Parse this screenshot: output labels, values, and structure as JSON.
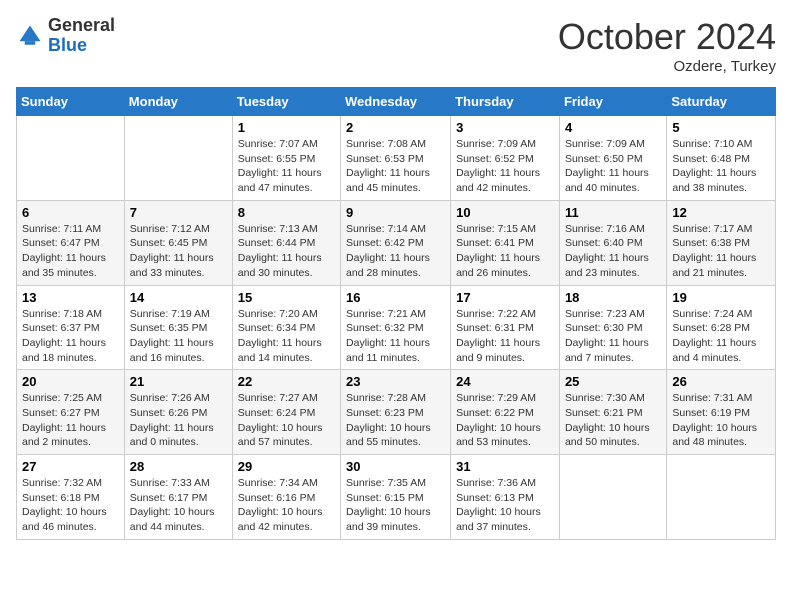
{
  "header": {
    "logo": {
      "general": "General",
      "blue": "Blue"
    },
    "title": "October 2024",
    "location": "Ozdere, Turkey"
  },
  "days_of_week": [
    "Sunday",
    "Monday",
    "Tuesday",
    "Wednesday",
    "Thursday",
    "Friday",
    "Saturday"
  ],
  "weeks": [
    [
      {
        "day": "",
        "sunrise": "",
        "sunset": "",
        "daylight": ""
      },
      {
        "day": "",
        "sunrise": "",
        "sunset": "",
        "daylight": ""
      },
      {
        "day": "1",
        "sunrise": "Sunrise: 7:07 AM",
        "sunset": "Sunset: 6:55 PM",
        "daylight": "Daylight: 11 hours and 47 minutes."
      },
      {
        "day": "2",
        "sunrise": "Sunrise: 7:08 AM",
        "sunset": "Sunset: 6:53 PM",
        "daylight": "Daylight: 11 hours and 45 minutes."
      },
      {
        "day": "3",
        "sunrise": "Sunrise: 7:09 AM",
        "sunset": "Sunset: 6:52 PM",
        "daylight": "Daylight: 11 hours and 42 minutes."
      },
      {
        "day": "4",
        "sunrise": "Sunrise: 7:09 AM",
        "sunset": "Sunset: 6:50 PM",
        "daylight": "Daylight: 11 hours and 40 minutes."
      },
      {
        "day": "5",
        "sunrise": "Sunrise: 7:10 AM",
        "sunset": "Sunset: 6:48 PM",
        "daylight": "Daylight: 11 hours and 38 minutes."
      }
    ],
    [
      {
        "day": "6",
        "sunrise": "Sunrise: 7:11 AM",
        "sunset": "Sunset: 6:47 PM",
        "daylight": "Daylight: 11 hours and 35 minutes."
      },
      {
        "day": "7",
        "sunrise": "Sunrise: 7:12 AM",
        "sunset": "Sunset: 6:45 PM",
        "daylight": "Daylight: 11 hours and 33 minutes."
      },
      {
        "day": "8",
        "sunrise": "Sunrise: 7:13 AM",
        "sunset": "Sunset: 6:44 PM",
        "daylight": "Daylight: 11 hours and 30 minutes."
      },
      {
        "day": "9",
        "sunrise": "Sunrise: 7:14 AM",
        "sunset": "Sunset: 6:42 PM",
        "daylight": "Daylight: 11 hours and 28 minutes."
      },
      {
        "day": "10",
        "sunrise": "Sunrise: 7:15 AM",
        "sunset": "Sunset: 6:41 PM",
        "daylight": "Daylight: 11 hours and 26 minutes."
      },
      {
        "day": "11",
        "sunrise": "Sunrise: 7:16 AM",
        "sunset": "Sunset: 6:40 PM",
        "daylight": "Daylight: 11 hours and 23 minutes."
      },
      {
        "day": "12",
        "sunrise": "Sunrise: 7:17 AM",
        "sunset": "Sunset: 6:38 PM",
        "daylight": "Daylight: 11 hours and 21 minutes."
      }
    ],
    [
      {
        "day": "13",
        "sunrise": "Sunrise: 7:18 AM",
        "sunset": "Sunset: 6:37 PM",
        "daylight": "Daylight: 11 hours and 18 minutes."
      },
      {
        "day": "14",
        "sunrise": "Sunrise: 7:19 AM",
        "sunset": "Sunset: 6:35 PM",
        "daylight": "Daylight: 11 hours and 16 minutes."
      },
      {
        "day": "15",
        "sunrise": "Sunrise: 7:20 AM",
        "sunset": "Sunset: 6:34 PM",
        "daylight": "Daylight: 11 hours and 14 minutes."
      },
      {
        "day": "16",
        "sunrise": "Sunrise: 7:21 AM",
        "sunset": "Sunset: 6:32 PM",
        "daylight": "Daylight: 11 hours and 11 minutes."
      },
      {
        "day": "17",
        "sunrise": "Sunrise: 7:22 AM",
        "sunset": "Sunset: 6:31 PM",
        "daylight": "Daylight: 11 hours and 9 minutes."
      },
      {
        "day": "18",
        "sunrise": "Sunrise: 7:23 AM",
        "sunset": "Sunset: 6:30 PM",
        "daylight": "Daylight: 11 hours and 7 minutes."
      },
      {
        "day": "19",
        "sunrise": "Sunrise: 7:24 AM",
        "sunset": "Sunset: 6:28 PM",
        "daylight": "Daylight: 11 hours and 4 minutes."
      }
    ],
    [
      {
        "day": "20",
        "sunrise": "Sunrise: 7:25 AM",
        "sunset": "Sunset: 6:27 PM",
        "daylight": "Daylight: 11 hours and 2 minutes."
      },
      {
        "day": "21",
        "sunrise": "Sunrise: 7:26 AM",
        "sunset": "Sunset: 6:26 PM",
        "daylight": "Daylight: 11 hours and 0 minutes."
      },
      {
        "day": "22",
        "sunrise": "Sunrise: 7:27 AM",
        "sunset": "Sunset: 6:24 PM",
        "daylight": "Daylight: 10 hours and 57 minutes."
      },
      {
        "day": "23",
        "sunrise": "Sunrise: 7:28 AM",
        "sunset": "Sunset: 6:23 PM",
        "daylight": "Daylight: 10 hours and 55 minutes."
      },
      {
        "day": "24",
        "sunrise": "Sunrise: 7:29 AM",
        "sunset": "Sunset: 6:22 PM",
        "daylight": "Daylight: 10 hours and 53 minutes."
      },
      {
        "day": "25",
        "sunrise": "Sunrise: 7:30 AM",
        "sunset": "Sunset: 6:21 PM",
        "daylight": "Daylight: 10 hours and 50 minutes."
      },
      {
        "day": "26",
        "sunrise": "Sunrise: 7:31 AM",
        "sunset": "Sunset: 6:19 PM",
        "daylight": "Daylight: 10 hours and 48 minutes."
      }
    ],
    [
      {
        "day": "27",
        "sunrise": "Sunrise: 7:32 AM",
        "sunset": "Sunset: 6:18 PM",
        "daylight": "Daylight: 10 hours and 46 minutes."
      },
      {
        "day": "28",
        "sunrise": "Sunrise: 7:33 AM",
        "sunset": "Sunset: 6:17 PM",
        "daylight": "Daylight: 10 hours and 44 minutes."
      },
      {
        "day": "29",
        "sunrise": "Sunrise: 7:34 AM",
        "sunset": "Sunset: 6:16 PM",
        "daylight": "Daylight: 10 hours and 42 minutes."
      },
      {
        "day": "30",
        "sunrise": "Sunrise: 7:35 AM",
        "sunset": "Sunset: 6:15 PM",
        "daylight": "Daylight: 10 hours and 39 minutes."
      },
      {
        "day": "31",
        "sunrise": "Sunrise: 7:36 AM",
        "sunset": "Sunset: 6:13 PM",
        "daylight": "Daylight: 10 hours and 37 minutes."
      },
      {
        "day": "",
        "sunrise": "",
        "sunset": "",
        "daylight": ""
      },
      {
        "day": "",
        "sunrise": "",
        "sunset": "",
        "daylight": ""
      }
    ]
  ]
}
